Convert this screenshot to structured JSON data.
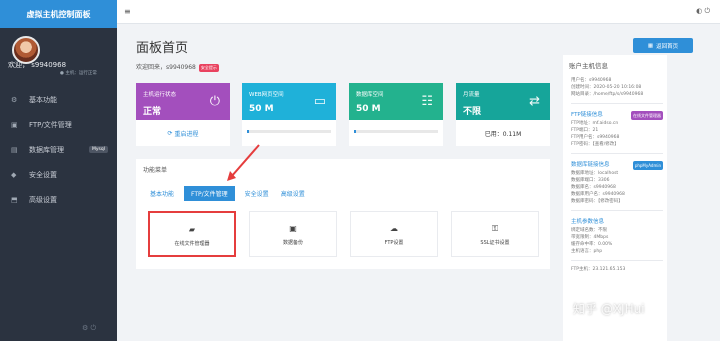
{
  "sidebar": {
    "title": "虚拟主机控制面板",
    "user_name": "欢迎，  s9940968",
    "user_status": "● 主机：运行正常",
    "items": [
      {
        "label": "基本功能",
        "icon": "gear-icon"
      },
      {
        "label": "FTP/文件管理",
        "icon": "folder-icon"
      },
      {
        "label": "数据库管理",
        "icon": "database-icon",
        "badge": "Mysql"
      },
      {
        "label": "安全设置",
        "icon": "shield-icon"
      },
      {
        "label": "高级设置",
        "icon": "advanced-icon"
      }
    ],
    "bottom_icons": "⚙  ⏻"
  },
  "topbar": {
    "menu_icon": "≡",
    "right_icons": "◐  ⏻"
  },
  "main": {
    "title": "面板首页",
    "welcome": "欢迎回来，s9940968",
    "security_badge": "安全提示",
    "home_button": "返回首页",
    "cards": [
      {
        "label": "主机运行状态",
        "value": "正常",
        "footer": "重启进程",
        "icon": "power-icon"
      },
      {
        "label": "WEB网页空间",
        "value": "50 M",
        "progress": 0.02,
        "icon": "storage-icon"
      },
      {
        "label": "数据库空间",
        "value": "50 M",
        "progress": 0.02,
        "icon": "database-icon"
      },
      {
        "label": "月流量",
        "value": "不限",
        "footer": "已用：0.11M",
        "icon": "transfer-icon"
      }
    ],
    "panel_title": "功能菜单",
    "tabs": [
      "基本功能",
      "FTP/文件管理",
      "安全设置",
      "高级设置"
    ],
    "tools": [
      {
        "label": "在线文件管理器",
        "icon": "folder-open-icon"
      },
      {
        "label": "数据备份",
        "icon": "copy-icon"
      },
      {
        "label": "FTP设置",
        "icon": "cloud-upload-icon"
      },
      {
        "label": "SSL证书设置",
        "icon": "key-icon"
      }
    ]
  },
  "account_info": {
    "title": "账户主机信息",
    "lines": [
      "用户名：s9940968",
      "创建时间：2020-05-20 10:16:08",
      "网站目录：/home/ftp/s/s9940968"
    ],
    "ftp_title": "FTP链接信息",
    "ftp_badge": "在线文件管理器",
    "ftp_lines": [
      "FTP地址：mf.aidso.cn",
      "FTP端口：21",
      "FTP用户名：s9940968",
      "FTP密码：【查看/修改】"
    ],
    "db_title": "数据库链接信息",
    "db_badge": "phpMyAdmin",
    "db_lines": [
      "数据库地址：localhost",
      "数据库端口：3306",
      "数据库名：s9940968",
      "数据库用户名：s9940968",
      "数据库密码：【修改密码】"
    ],
    "host_title": "主机参数信息",
    "host_lines": [
      "绑定域名数：不限",
      "带宽限制：4Mbps",
      "缓存命中率：0.00%",
      "主机语言：php"
    ],
    "footer_line": "FTP主机：23.121.65.153"
  },
  "watermark": "知乎 @XJHui"
}
